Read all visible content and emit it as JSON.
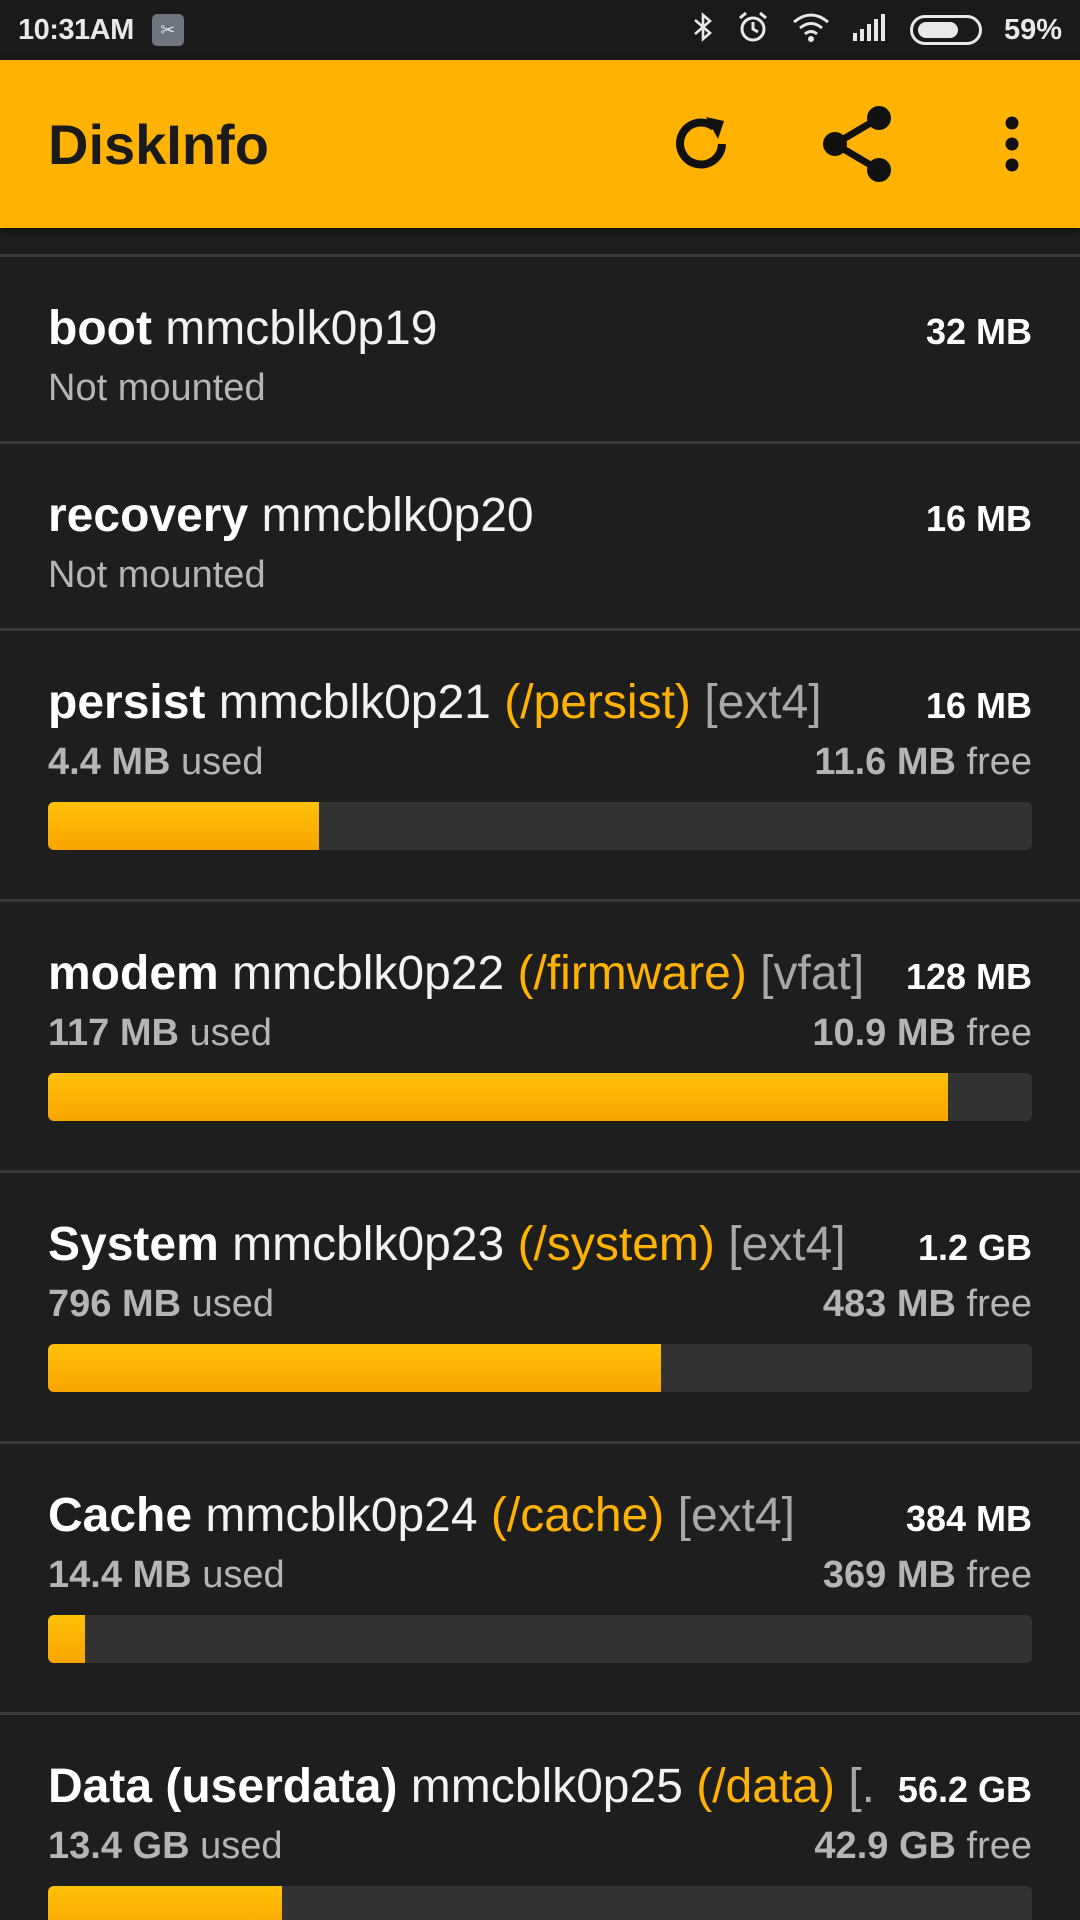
{
  "status_bar": {
    "time": "10:31AM",
    "battery": "59%",
    "icons": [
      "notification-icon",
      "bluetooth-icon",
      "alarm-icon",
      "wifi-icon",
      "signal-icon",
      "battery-icon"
    ]
  },
  "app_bar": {
    "title": "DiskInfo",
    "actions": [
      "refresh-icon",
      "share-icon",
      "more-options-icon"
    ],
    "color": "#ffb300"
  },
  "partitions": [
    {
      "name": "boot",
      "device": "mmcblk0p19",
      "status": "Not mounted",
      "size": "32 MB"
    },
    {
      "name": "recovery",
      "device": "mmcblk0p20",
      "status": "Not mounted",
      "size": "16 MB"
    },
    {
      "name": "persist",
      "device": "mmcblk0p21",
      "mount": "(/persist)",
      "fs": "[ext4]",
      "size": "16 MB",
      "used_value": "4.4 MB",
      "used_label": "used",
      "free_value": "11.6 MB",
      "free_label": "free",
      "usage_fraction": 0.275
    },
    {
      "name": "modem",
      "device": "mmcblk0p22",
      "mount": "(/firmware)",
      "fs": "[vfat]",
      "size": "128 MB",
      "used_value": "117 MB",
      "used_label": "used",
      "free_value": "10.9 MB",
      "free_label": "free",
      "usage_fraction": 0.915
    },
    {
      "name": "System",
      "device": "mmcblk0p23",
      "mount": "(/system)",
      "fs": "[ext4]",
      "size": "1.2 GB",
      "used_value": "796 MB",
      "used_label": "used",
      "free_value": "483 MB",
      "free_label": "free",
      "usage_fraction": 0.623
    },
    {
      "name": "Cache",
      "device": "mmcblk0p24",
      "mount": "(/cache)",
      "fs": "[ext4]",
      "size": "384 MB",
      "used_value": "14.4 MB",
      "used_label": "used",
      "free_value": "369 MB",
      "free_label": "free",
      "usage_fraction": 0.038
    },
    {
      "name": "Data (userdata)",
      "device": "mmcblk0p25",
      "mount": "(/data)",
      "fs": "[...",
      "size": "56.2 GB",
      "used_value": "13.4 GB",
      "used_label": "used",
      "free_value": "42.9 GB",
      "free_label": "free",
      "usage_fraction": 0.238
    }
  ]
}
